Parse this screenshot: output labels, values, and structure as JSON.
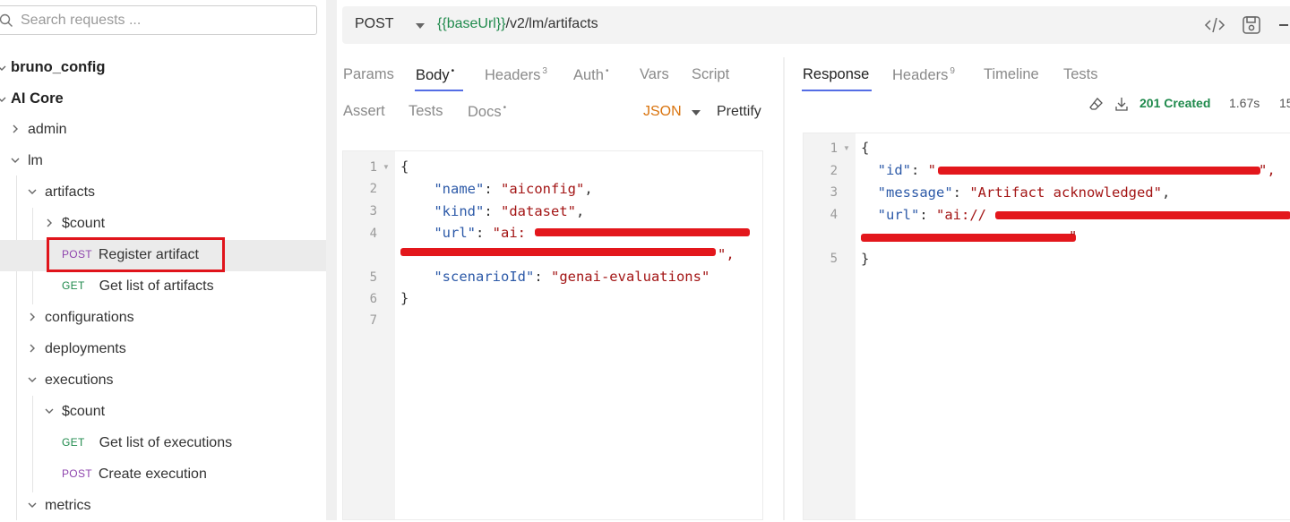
{
  "sidebar": {
    "search_placeholder": "Search requests ...",
    "items": [
      {
        "label": "bruno_config"
      },
      {
        "label": "AI Core"
      },
      {
        "label": "admin"
      },
      {
        "label": "lm"
      },
      {
        "label": "artifacts"
      },
      {
        "label": "$count"
      },
      {
        "method": "POST",
        "label": "Register artifact",
        "selected": true
      },
      {
        "method": "GET",
        "label": "Get list of artifacts"
      },
      {
        "label": "configurations"
      },
      {
        "label": "deployments"
      },
      {
        "label": "executions"
      },
      {
        "label": "$count"
      },
      {
        "method": "GET",
        "label": "Get list of executions"
      },
      {
        "method": "POST",
        "label": "Create execution"
      },
      {
        "label": "metrics"
      }
    ]
  },
  "request": {
    "method": "POST",
    "url_var": "{{baseUrl}}",
    "url_path": "/v2/lm/artifacts",
    "tabs": [
      {
        "label": "Params",
        "badge": ""
      },
      {
        "label": "Body",
        "badge": "•"
      },
      {
        "label": "Headers",
        "badge": "3"
      },
      {
        "label": "Auth",
        "badge": "•"
      },
      {
        "label": "Vars",
        "badge": ""
      },
      {
        "label": "Script",
        "badge": ""
      },
      {
        "label": "Assert",
        "badge": ""
      },
      {
        "label": "Tests",
        "badge": ""
      },
      {
        "label": "Docs",
        "badge": "•"
      }
    ],
    "active_tab": "Body",
    "body_mode": "JSON",
    "prettify_label": "Prettify",
    "line_numbers": [
      "1",
      "2",
      "3",
      "4",
      "5",
      "6",
      "7"
    ],
    "body_lines": {
      "l1": "{",
      "name_key": "\"name\"",
      "name_val": "\"aiconfig\"",
      "kind_key": "\"kind\"",
      "kind_val": "\"dataset\"",
      "url_key": "\"url\"",
      "url_val_visible": "\"ai:",
      "url_tail": "\",",
      "scen_key": "\"scenarioId\"",
      "scen_val": "\"genai-evaluations\"",
      "close": "}"
    }
  },
  "response": {
    "tabs": [
      {
        "label": "Response",
        "badge": ""
      },
      {
        "label": "Headers",
        "badge": "9"
      },
      {
        "label": "Timeline",
        "badge": ""
      },
      {
        "label": "Tests",
        "badge": ""
      }
    ],
    "active_tab": "Response",
    "status": "201 Created",
    "time": "1.67s",
    "size": "15",
    "line_numbers": [
      "1",
      "2",
      "3",
      "4",
      "5"
    ],
    "body_lines": {
      "open": "{",
      "id_key": "\"id\"",
      "id_val_start": "\"",
      "id_val_end": "\",",
      "msg_key": "\"message\"",
      "msg_val": "\"Artifact acknowledged\"",
      "url_key": "\"url\"",
      "url_val_start": "\"ai://",
      "url_val_cont_end": "\"",
      "close": "}"
    }
  },
  "colors": {
    "accent_underline": "#546de5",
    "status_ok": "#1f8a4c",
    "redaction": "#e3171c",
    "highlight_box": "#e0141b",
    "json_mode": "#d9730d"
  }
}
